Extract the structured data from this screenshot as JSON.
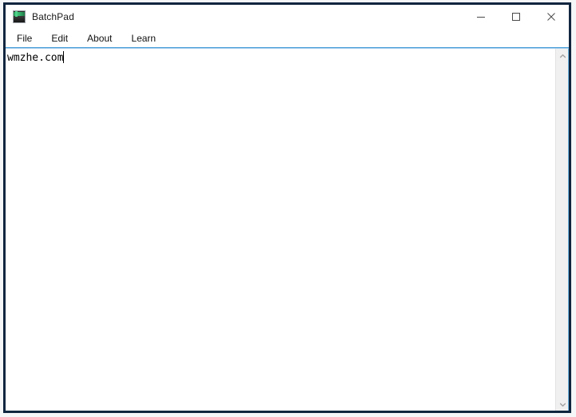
{
  "window": {
    "title": "BatchPad",
    "icon": "app-icon",
    "controls": {
      "minimize": {
        "name": "minimize-button",
        "glyph": "minimize-icon",
        "tooltip": "Minimize"
      },
      "maximize": {
        "name": "maximize-button",
        "glyph": "maximize-icon",
        "tooltip": "Maximize"
      },
      "close": {
        "name": "close-button",
        "glyph": "close-icon",
        "tooltip": "Close"
      }
    },
    "frame_color": "#10253f",
    "background": "#ffffff"
  },
  "menubar": {
    "items": [
      {
        "label": "File"
      },
      {
        "label": "Edit"
      },
      {
        "label": "About"
      },
      {
        "label": "Learn"
      }
    ],
    "separator_color": "#4a9fd8"
  },
  "editor": {
    "text": "wmzhe.com",
    "caret_visible": true,
    "placeholder": "",
    "font": "monospace",
    "text_color": "#000000",
    "background": "#ffffff"
  },
  "scrollbar": {
    "orientation": "vertical",
    "up_arrow": "chevron-up-icon",
    "down_arrow": "chevron-down-icon",
    "track_color": "#f0f0f0",
    "thumb_visible": false
  }
}
